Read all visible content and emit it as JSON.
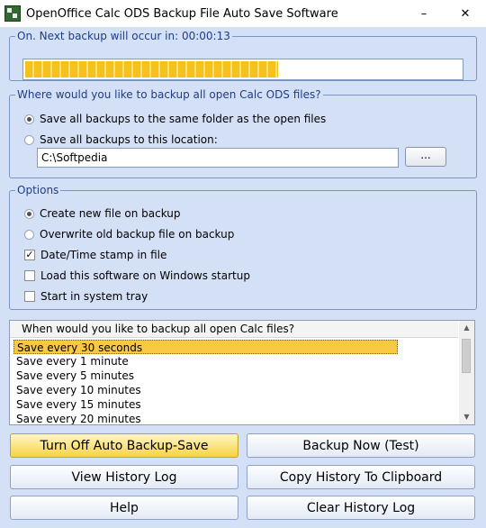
{
  "window": {
    "title": "OpenOffice Calc ODS Backup File Auto Save Software",
    "minimize_glyph": "–",
    "close_glyph": "✕"
  },
  "status": {
    "legend": "On. Next backup will occur in: 00:00:13",
    "progress_fraction": 0.58
  },
  "location": {
    "legend": "Where would you like to backup all open Calc ODS files?",
    "option_same_folder": "Save all backups to the same folder as the open files",
    "option_custom": "Save all backups to this location:",
    "path_value": "C:\\Softpedia",
    "browse_label": "...",
    "selected": "same_folder"
  },
  "options": {
    "legend": "Options",
    "create_new": "Create new file on backup",
    "overwrite": "Overwrite old backup file on backup",
    "datetime_stamp": "Date/Time stamp in file",
    "load_startup": "Load this software on Windows startup",
    "system_tray": "Start in system tray",
    "checked_datetime": true,
    "checked_startup": false,
    "checked_tray": false
  },
  "interval_list": {
    "header": "When would you like to backup all open Calc files?",
    "items": [
      "Save every 30 seconds",
      "Save every 1 minute",
      "Save every 5 minutes",
      "Save every 10 minutes",
      "Save every 15 minutes",
      "Save every 20 minutes"
    ],
    "selected_index": 0
  },
  "buttons": {
    "toggle_auto": "Turn Off Auto Backup-Save",
    "backup_now": "Backup Now (Test)",
    "view_history": "View History Log",
    "copy_history": "Copy History To Clipboard",
    "help": "Help",
    "clear_history": "Clear History Log"
  },
  "colors": {
    "accent": "#f5c21c",
    "legend_text": "#1f3d86",
    "background": "#d4e0f5"
  }
}
